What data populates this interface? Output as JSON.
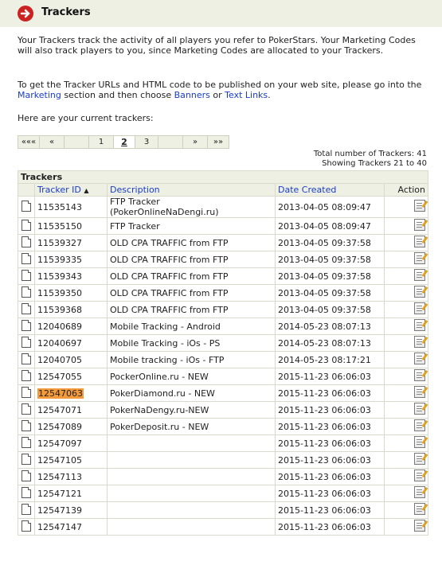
{
  "header": {
    "title": "Trackers",
    "icon": "arrow-circle-icon",
    "color": "#cc2222"
  },
  "intro": {
    "p1": "Your Trackers track the activity of all players you refer to PokerStars. Your Marketing Codes will also track players to you, since Marketing Codes are allocated to your Trackers.",
    "p2_before": "To get the Tracker URLs and HTML code to be published on your web site, please go into the ",
    "p2_marketing": "Marketing",
    "p2_mid": " section and then choose ",
    "p2_banners": "Banners",
    "p2_or": " or ",
    "p2_textlinks": "Text Links",
    "p2_end": ".",
    "p3": "Here are your current trackers:"
  },
  "pager": {
    "first": "«««",
    "prev": "«",
    "p1": "1",
    "p2": "2",
    "p3": "3",
    "next": "»",
    "last": "»»"
  },
  "totals": {
    "total": "Total number of Trackers: 41",
    "showing": "Showing Trackers 21 to 40"
  },
  "table": {
    "title": "Trackers",
    "col_id": "Tracker ID",
    "sort_arrow": "▲",
    "col_desc": "Description",
    "col_date": "Date Created",
    "col_action": "Action",
    "rows": [
      {
        "id": "11535143",
        "desc": "FTP Tracker",
        "desc2": "(PokerOnlineNaDengi.ru)",
        "date": "2013-04-05 08:09:47"
      },
      {
        "id": "11535150",
        "desc": "FTP Tracker",
        "date": "2013-04-05 08:09:47"
      },
      {
        "id": "11539327",
        "desc": "OLD CPA TRAFFIC from FTP",
        "date": "2013-04-05 09:37:58"
      },
      {
        "id": "11539335",
        "desc": "OLD CPA TRAFFIC from FTP",
        "date": "2013-04-05 09:37:58"
      },
      {
        "id": "11539343",
        "desc": "OLD CPA TRAFFIC from FTP",
        "date": "2013-04-05 09:37:58"
      },
      {
        "id": "11539350",
        "desc": "OLD CPA TRAFFIC from FTP",
        "date": "2013-04-05 09:37:58"
      },
      {
        "id": "11539368",
        "desc": "OLD CPA TRAFFIC from FTP",
        "date": "2013-04-05 09:37:58"
      },
      {
        "id": "12040689",
        "desc": "Mobile Tracking - Android",
        "date": "2014-05-23 08:07:13"
      },
      {
        "id": "12040697",
        "desc": "Mobile Tracking - iOs - PS",
        "date": "2014-05-23 08:07:13"
      },
      {
        "id": "12040705",
        "desc": "Mobile tracking - iOs - FTP",
        "date": "2014-05-23 08:17:21"
      },
      {
        "id": "12547055",
        "desc": "PockerOnline.ru - NEW",
        "date": "2015-11-23 06:06:03"
      },
      {
        "id": "12547063",
        "desc": "PokerDiamond.ru - NEW",
        "date": "2015-11-23 06:06:03"
      },
      {
        "id": "12547071",
        "desc": "PokerNaDengy.ru-NEW",
        "date": "2015-11-23 06:06:03"
      },
      {
        "id": "12547089",
        "desc": "PokerDeposit.ru - NEW",
        "date": "2015-11-23 06:06:03"
      },
      {
        "id": "12547097",
        "desc": "",
        "date": "2015-11-23 06:06:03"
      },
      {
        "id": "12547105",
        "desc": "",
        "date": "2015-11-23 06:06:03"
      },
      {
        "id": "12547113",
        "desc": "",
        "date": "2015-11-23 06:06:03"
      },
      {
        "id": "12547121",
        "desc": "",
        "date": "2015-11-23 06:06:03"
      },
      {
        "id": "12547139",
        "desc": "",
        "date": "2015-11-23 06:06:03"
      },
      {
        "id": "12547147",
        "desc": "",
        "date": "2015-11-23 06:06:03"
      }
    ],
    "highlight_color": "#f59a3a"
  }
}
